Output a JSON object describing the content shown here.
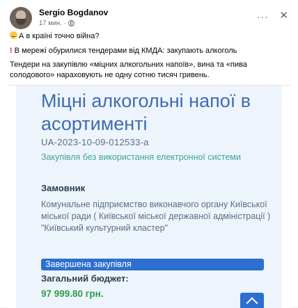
{
  "post": {
    "author": "Sergio Bogdanov",
    "time": "17 мин.",
    "separator": "·",
    "more_label": "···",
    "close_label": "✕",
    "line1": "А в країні точно війна?",
    "line2": "В мережі обурилися тендерами від КМДА: закупають алкоголь",
    "line3": "Тендери на закупівлю «міцних алкогольних напоїв», вина та «пива солодового» нараховують не одну сотню тисяч гривень."
  },
  "image": {
    "title": "Міцні алкогольні напої в асортименті",
    "tender_id": "UA-2023-10-09-012533-a",
    "procedure": "Закупівля без використання електронної системи",
    "customer_label": "Замовник",
    "customer_name": "Комунальне підприємство виконавчого органу Київської міської ради ( Київської міської державної адміністрації ) \"Київський культурний кластер\"",
    "status": "Завершена закупівля",
    "budget_label": "Загальний бюджет:",
    "budget_value": "97 999.80 грн."
  },
  "colors": {
    "title": "#3d6db1",
    "procedure": "#3fa59a",
    "status_bg": "#2d6fd1",
    "budget": "#2e9d4a"
  }
}
